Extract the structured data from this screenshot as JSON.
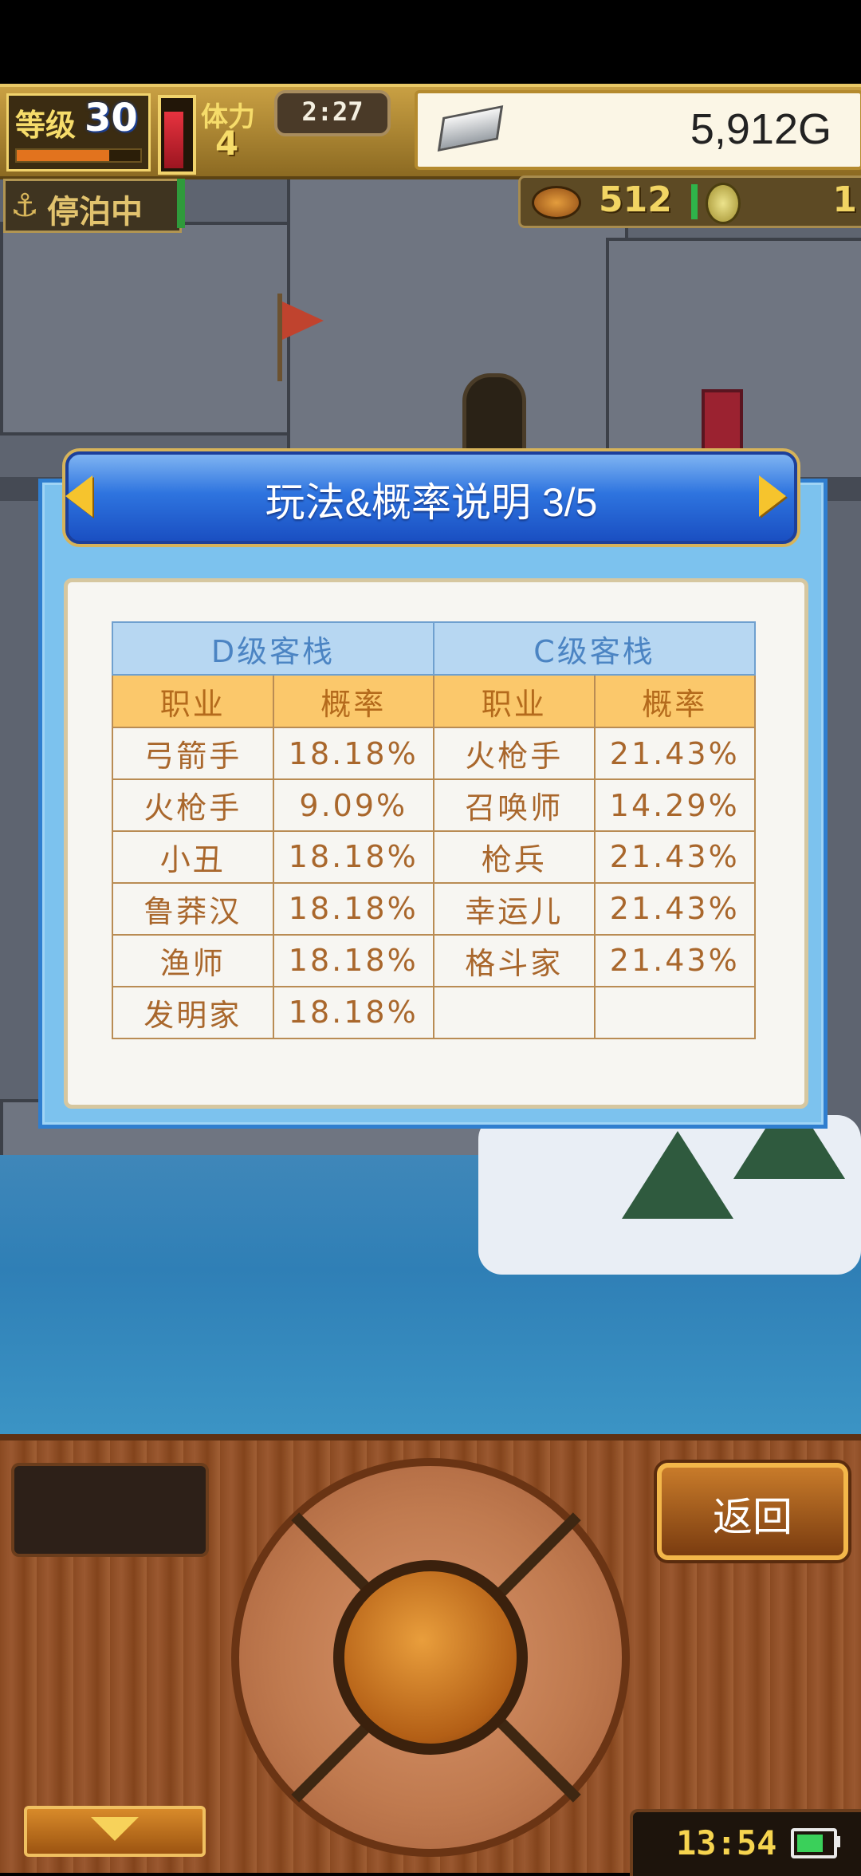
{
  "hud": {
    "level_label": "等级",
    "level_value": "30",
    "level_progress": 0.75,
    "stamina_label": "体力",
    "stamina_value": "4",
    "stamina_level": 0.85,
    "timer": "2:27",
    "gold": "5,912G",
    "icons": [
      "silver-ingot-icon",
      "drum-icon",
      "coin-icon"
    ]
  },
  "status": {
    "mooring": "停泊中",
    "resource_count": "512",
    "coin_count": "1"
  },
  "dialog": {
    "title": "玩法&概率说明 3/5",
    "prev_icon": "left-arrow-icon",
    "next_icon": "right-arrow-icon",
    "table": {
      "groups": [
        "D级客栈",
        "C级客栈"
      ],
      "headers": [
        "职业",
        "概率",
        "职业",
        "概率"
      ],
      "rows": [
        [
          "弓箭手",
          "18.18%",
          "火枪手",
          "21.43%"
        ],
        [
          "火枪手",
          "9.09%",
          "召唤师",
          "14.29%"
        ],
        [
          "小丑",
          "18.18%",
          "枪兵",
          "21.43%"
        ],
        [
          "鲁莽汉",
          "18.18%",
          "幸运儿",
          "21.43%"
        ],
        [
          "渔师",
          "18.18%",
          "格斗家",
          "21.43%"
        ],
        [
          "发明家",
          "18.18%",
          "",
          ""
        ]
      ]
    }
  },
  "controls": {
    "back_label": "返回",
    "clock": "13:54",
    "battery_level": 0.75
  },
  "colors": {
    "title_bar": "#2e74df",
    "group_header": "#b7d7f2",
    "column_header": "#fbc86b",
    "cell_text": "#a9672c",
    "gold_text": "#f2d563"
  }
}
